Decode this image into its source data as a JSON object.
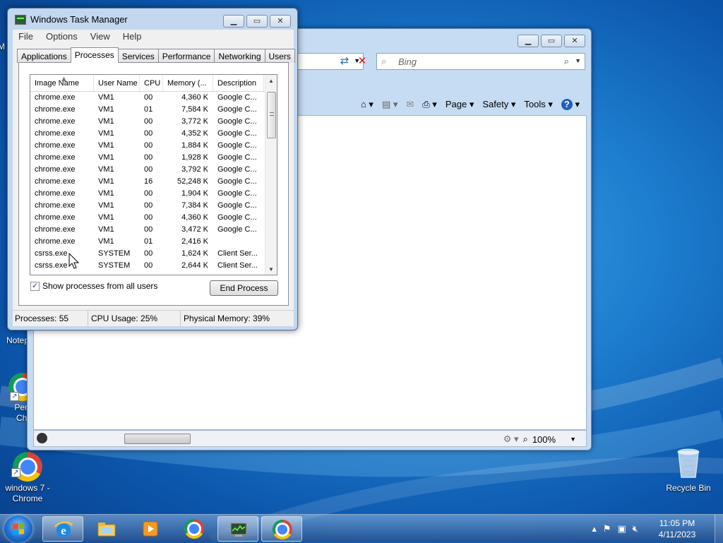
{
  "ie": {
    "search_placeholder": "Bing",
    "cmd": {
      "page": "Page",
      "safety": "Safety",
      "tools": "Tools"
    },
    "zoom": "100%"
  },
  "desktop": {
    "icon_notepad_label": "Notep",
    "icon_personal_chrome_label": "Perso\nChro",
    "icon_win7_chrome_label": "windows 7 -\nChrome",
    "icon_recycle_label": "Recycle Bin",
    "edge_label_m": "M"
  },
  "task_manager": {
    "title": "Windows Task Manager",
    "menu": [
      "File",
      "Options",
      "View",
      "Help"
    ],
    "tabs": [
      "Applications",
      "Processes",
      "Services",
      "Performance",
      "Networking",
      "Users"
    ],
    "active_tab": "Processes",
    "columns": [
      "Image Name",
      "User Name",
      "CPU",
      "Memory (...",
      "Description"
    ],
    "rows": [
      [
        "chrome.exe",
        "VM1",
        "00",
        "4,360 K",
        "Google C..."
      ],
      [
        "chrome.exe",
        "VM1",
        "01",
        "7,584 K",
        "Google C..."
      ],
      [
        "chrome.exe",
        "VM1",
        "00",
        "3,772 K",
        "Google C..."
      ],
      [
        "chrome.exe",
        "VM1",
        "00",
        "4,352 K",
        "Google C..."
      ],
      [
        "chrome.exe",
        "VM1",
        "00",
        "1,884 K",
        "Google C..."
      ],
      [
        "chrome.exe",
        "VM1",
        "00",
        "1,928 K",
        "Google C..."
      ],
      [
        "chrome.exe",
        "VM1",
        "00",
        "3,792 K",
        "Google C..."
      ],
      [
        "chrome.exe",
        "VM1",
        "16",
        "52,248 K",
        "Google C..."
      ],
      [
        "chrome.exe",
        "VM1",
        "00",
        "1,904 K",
        "Google C..."
      ],
      [
        "chrome.exe",
        "VM1",
        "00",
        "7,384 K",
        "Google C..."
      ],
      [
        "chrome.exe",
        "VM1",
        "00",
        "4,360 K",
        "Google C..."
      ],
      [
        "chrome.exe",
        "VM1",
        "00",
        "3,472 K",
        "Google C..."
      ],
      [
        "chrome.exe",
        "VM1",
        "01",
        "2,416 K",
        ""
      ],
      [
        "csrss.exe",
        "SYSTEM",
        "00",
        "1,624 K",
        "Client Ser..."
      ],
      [
        "csrss.exe",
        "SYSTEM",
        "00",
        "2,644 K",
        "Client Ser..."
      ]
    ],
    "show_all_label": "Show processes from all users",
    "show_all_checked": true,
    "end_process_label": "End Process",
    "status": {
      "processes": "Processes: 55",
      "cpu": "CPU Usage: 25%",
      "memory": "Physical Memory: 39%"
    }
  },
  "taskbar": {
    "time": "11:05 PM",
    "date": "4/11/2023"
  },
  "colors": {
    "desktop_blue": "#1e7fd0",
    "window_frame": "#c3d8ef",
    "close_x_red": "#d11a1a"
  },
  "icons": {
    "tray": [
      "chevron-up-icon",
      "flag-icon",
      "network-icon",
      "speaker-muted-icon"
    ],
    "taskbar": [
      "ie-icon",
      "explorer-icon",
      "media-player-icon",
      "chrome-icon",
      "task-manager-icon",
      "chrome-icon"
    ]
  }
}
